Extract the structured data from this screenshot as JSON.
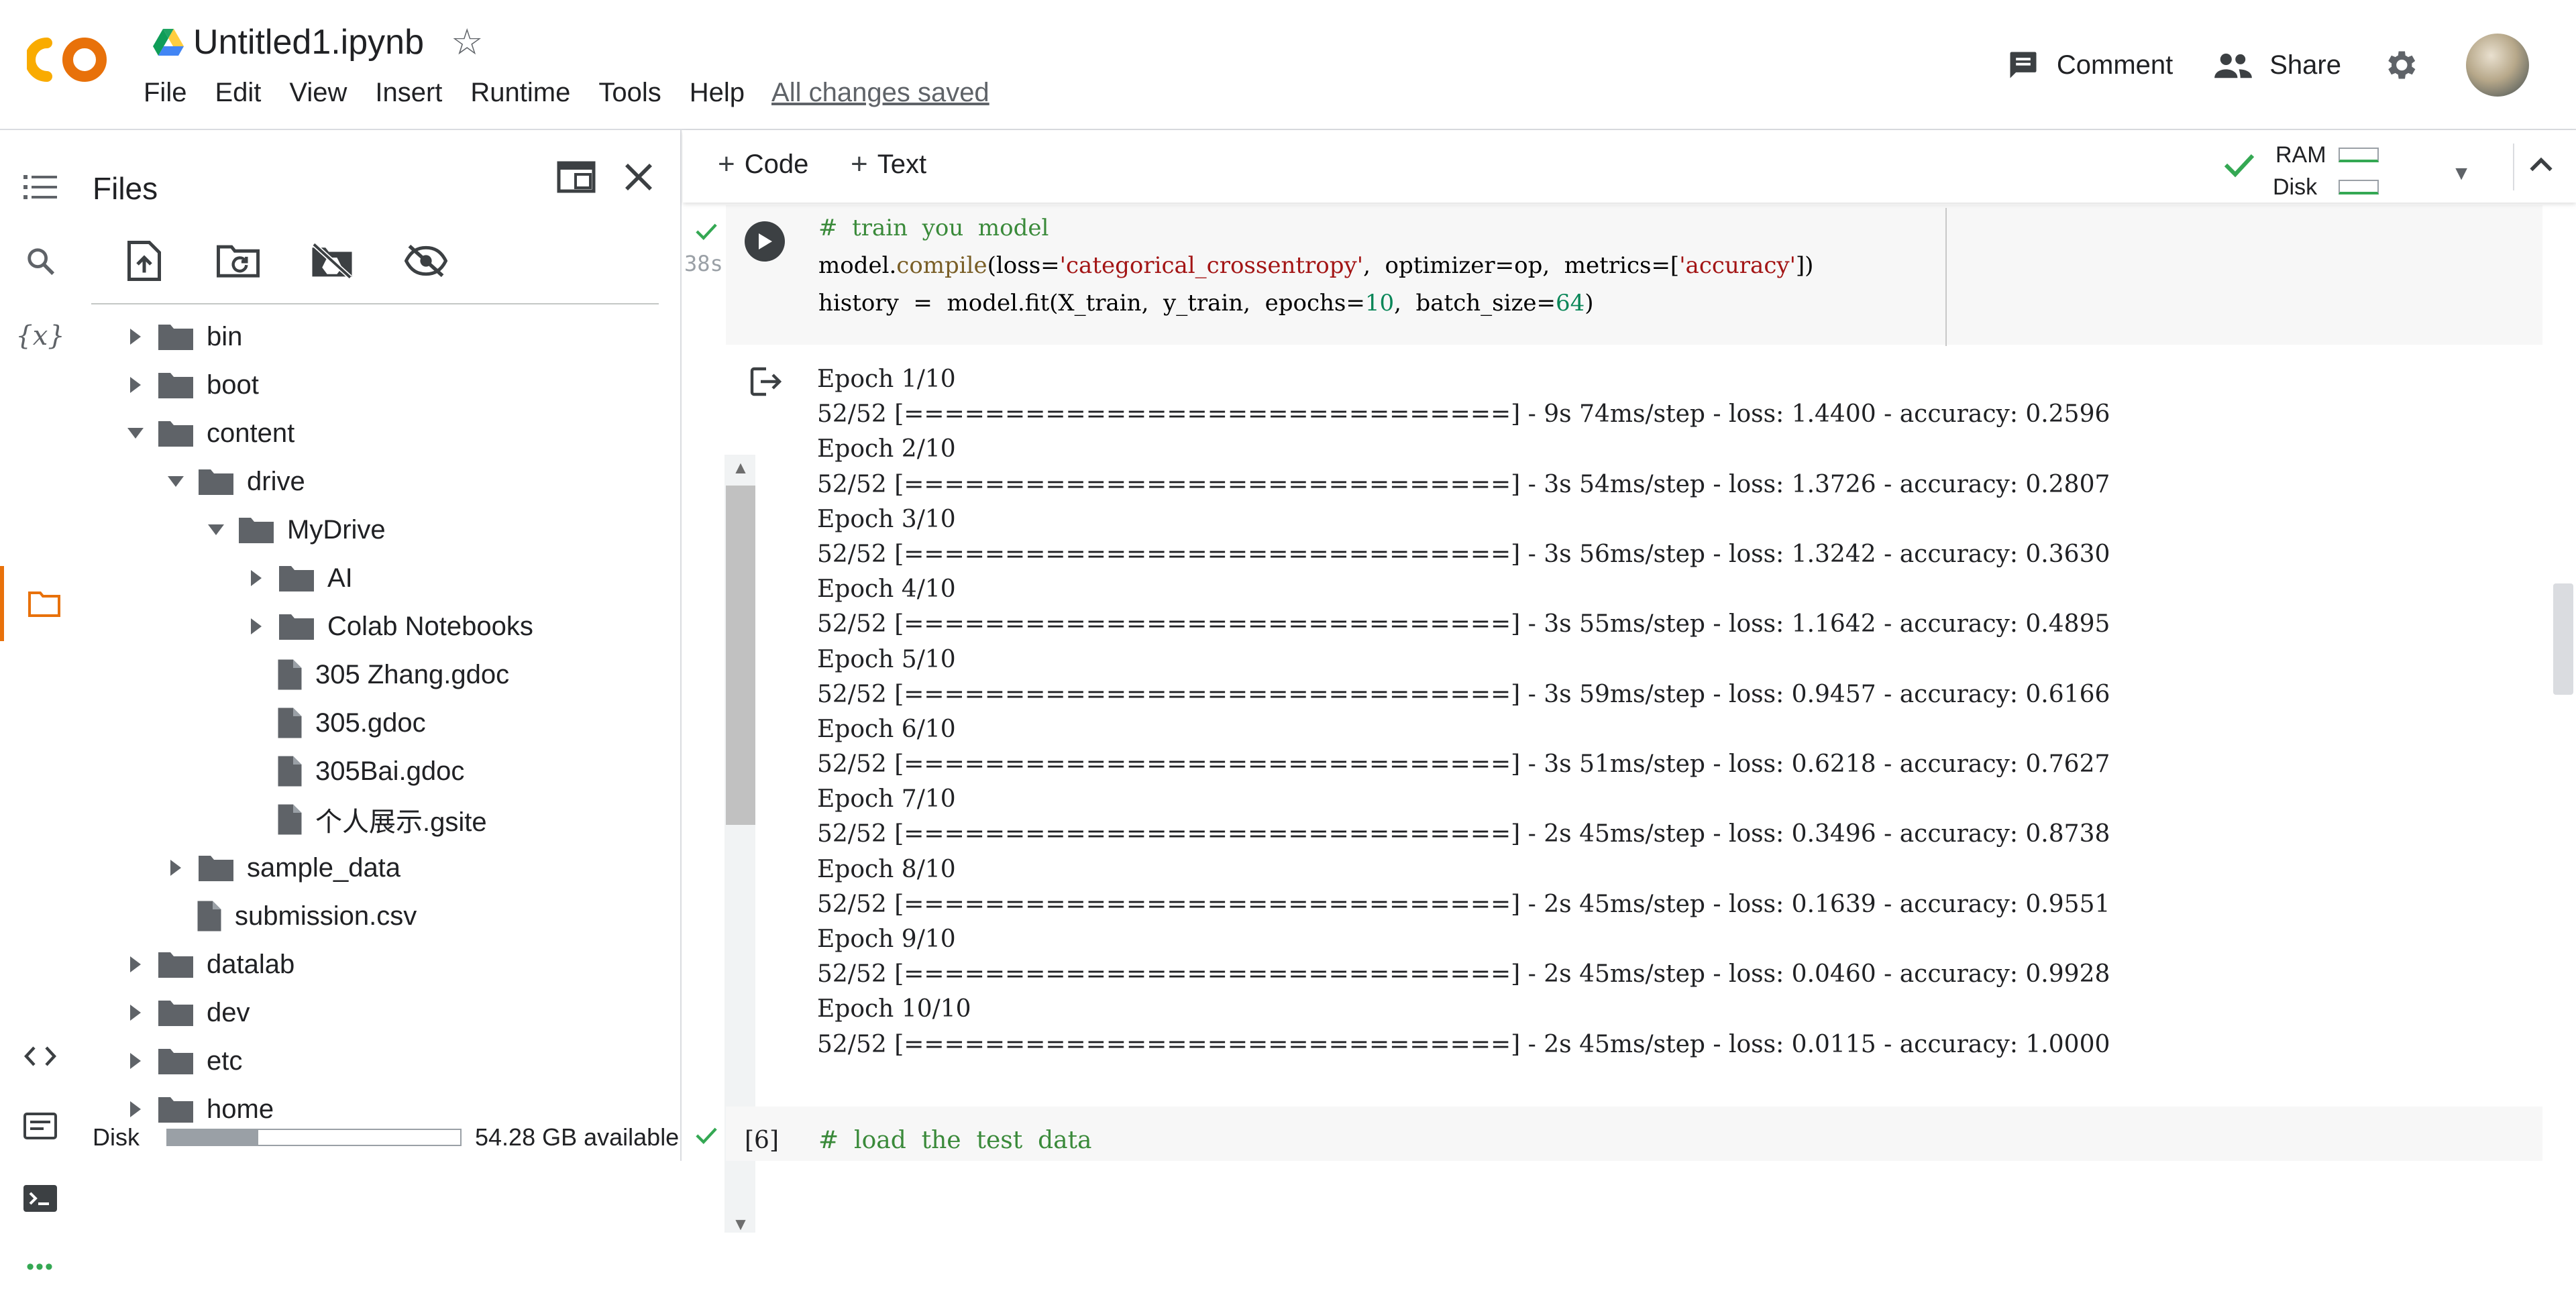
{
  "app": {
    "logo_text": "CO",
    "title": "Untitled1.ipynb",
    "menu": [
      "File",
      "Edit",
      "View",
      "Insert",
      "Runtime",
      "Tools",
      "Help"
    ],
    "save_status": "All changes saved",
    "comment_label": "Comment",
    "share_label": "Share"
  },
  "files_panel": {
    "title": "Files",
    "tree": [
      {
        "label": "bin",
        "type": "folder",
        "depth": 0,
        "expanded": false
      },
      {
        "label": "boot",
        "type": "folder",
        "depth": 0,
        "expanded": false
      },
      {
        "label": "content",
        "type": "folder",
        "depth": 0,
        "expanded": true
      },
      {
        "label": "drive",
        "type": "folder",
        "depth": 1,
        "expanded": true
      },
      {
        "label": "MyDrive",
        "type": "folder",
        "depth": 2,
        "expanded": true
      },
      {
        "label": "AI",
        "type": "folder",
        "depth": 3,
        "expanded": false
      },
      {
        "label": "Colab Notebooks",
        "type": "folder",
        "depth": 3,
        "expanded": false
      },
      {
        "label": "305 Zhang.gdoc",
        "type": "file",
        "depth": 3
      },
      {
        "label": "305.gdoc",
        "type": "file",
        "depth": 3
      },
      {
        "label": "305Bai.gdoc",
        "type": "file",
        "depth": 3
      },
      {
        "label": "个人展示.gsite",
        "type": "file",
        "depth": 3
      },
      {
        "label": "sample_data",
        "type": "folder",
        "depth": 1,
        "expanded": false
      },
      {
        "label": "submission.csv",
        "type": "file",
        "depth": 1
      },
      {
        "label": "datalab",
        "type": "folder",
        "depth": 0,
        "expanded": false
      },
      {
        "label": "dev",
        "type": "folder",
        "depth": 0,
        "expanded": false
      },
      {
        "label": "etc",
        "type": "folder",
        "depth": 0,
        "expanded": false
      },
      {
        "label": "home",
        "type": "folder",
        "depth": 0,
        "expanded": false
      }
    ],
    "disk_label": "Disk",
    "disk_used_fraction": 0.31,
    "disk_available": "54.28 GB available"
  },
  "toolbar": {
    "code_label": "Code",
    "text_label": "Text",
    "ram_label": "RAM",
    "disk_label": "Disk"
  },
  "cell1": {
    "exec_time": "38s",
    "comment": "#  train  you  model",
    "line2_a": "model.",
    "line2_fn": "compile",
    "line2_b": "(loss=",
    "line2_str": "'categorical_crossentropy'",
    "line2_c": ",  optimizer=op,  metrics=[",
    "line2_str2": "'accuracy'",
    "line2_d": "])",
    "line3_a": "history  =  model.fit(X_train,  y_train,  epochs=",
    "line3_num": "10",
    "line3_b": ",  batch_size=",
    "line3_num2": "64",
    "line3_c": ")"
  },
  "output_lines": [
    "Epoch 1/10",
    "52/52 [==============================] - 9s 74ms/step - loss: 1.4400 - accuracy: 0.2596",
    "Epoch 2/10",
    "52/52 [==============================] - 3s 54ms/step - loss: 1.3726 - accuracy: 0.2807",
    "Epoch 3/10",
    "52/52 [==============================] - 3s 56ms/step - loss: 1.3242 - accuracy: 0.3630",
    "Epoch 4/10",
    "52/52 [==============================] - 3s 55ms/step - loss: 1.1642 - accuracy: 0.4895",
    "Epoch 5/10",
    "52/52 [==============================] - 3s 59ms/step - loss: 0.9457 - accuracy: 0.6166",
    "Epoch 6/10",
    "52/52 [==============================] - 3s 51ms/step - loss: 0.6218 - accuracy: 0.7627",
    "Epoch 7/10",
    "52/52 [==============================] - 2s 45ms/step - loss: 0.3496 - accuracy: 0.8738",
    "Epoch 8/10",
    "52/52 [==============================] - 2s 45ms/step - loss: 0.1639 - accuracy: 0.9551",
    "Epoch 9/10",
    "52/52 [==============================] - 2s 45ms/step - loss: 0.0460 - accuracy: 0.9928",
    "Epoch 10/10",
    "52/52 [==============================] - 2s 45ms/step - loss: 0.0115 - accuracy: 1.0000"
  ],
  "cell2": {
    "exec_count": "[6]",
    "code": "#  load  the  test  data"
  },
  "colors": {
    "accent": "#e8710a",
    "logo_orange": "#f9ab00",
    "check_green": "#34a853"
  }
}
